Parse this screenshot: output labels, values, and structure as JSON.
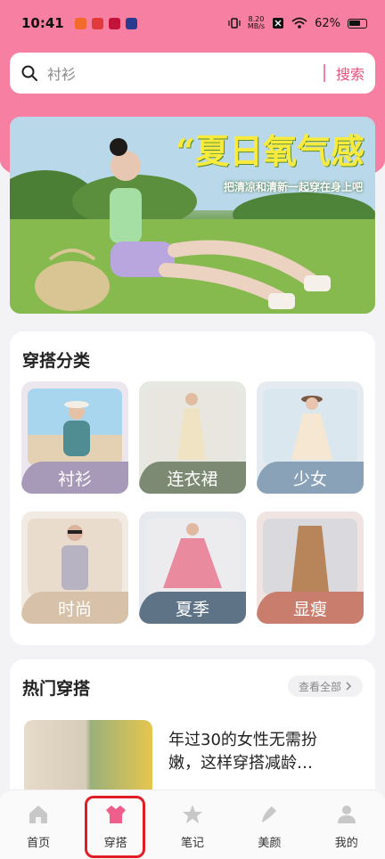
{
  "status": {
    "time": "10:41",
    "net_speed": "8.20\nMB/s",
    "battery": "62%"
  },
  "search": {
    "placeholder": "衬衫",
    "button": "搜索"
  },
  "banner": {
    "headline": "“夏日氧气感",
    "subtitle": "把清凉和清新一起穿在身上吧"
  },
  "categories": {
    "title": "穿搭分类",
    "items": [
      {
        "label": "衬衫",
        "color": "#a79ab9"
      },
      {
        "label": "连衣裙",
        "color": "#7d8a73"
      },
      {
        "label": "少女",
        "color": "#8aa2b8"
      },
      {
        "label": "时尚",
        "color": "#d7c1a8"
      },
      {
        "label": "夏季",
        "color": "#5f7386"
      },
      {
        "label": "显瘦",
        "color": "#c97d6c"
      }
    ]
  },
  "hot": {
    "title": "热门穿搭",
    "see_all": "查看全部",
    "article_title": "年过30的女性无需扮嫩，这样穿搭减龄…"
  },
  "nav": {
    "items": [
      {
        "label": "首页",
        "icon": "home-icon"
      },
      {
        "label": "穿搭",
        "icon": "outfit-icon"
      },
      {
        "label": "笔记",
        "icon": "star-notes-icon"
      },
      {
        "label": "美颜",
        "icon": "beauty-icon"
      },
      {
        "label": "我的",
        "icon": "profile-icon"
      }
    ]
  },
  "colors": {
    "brand_pink": "#f67fa2",
    "accent_red": "#e11d26"
  }
}
